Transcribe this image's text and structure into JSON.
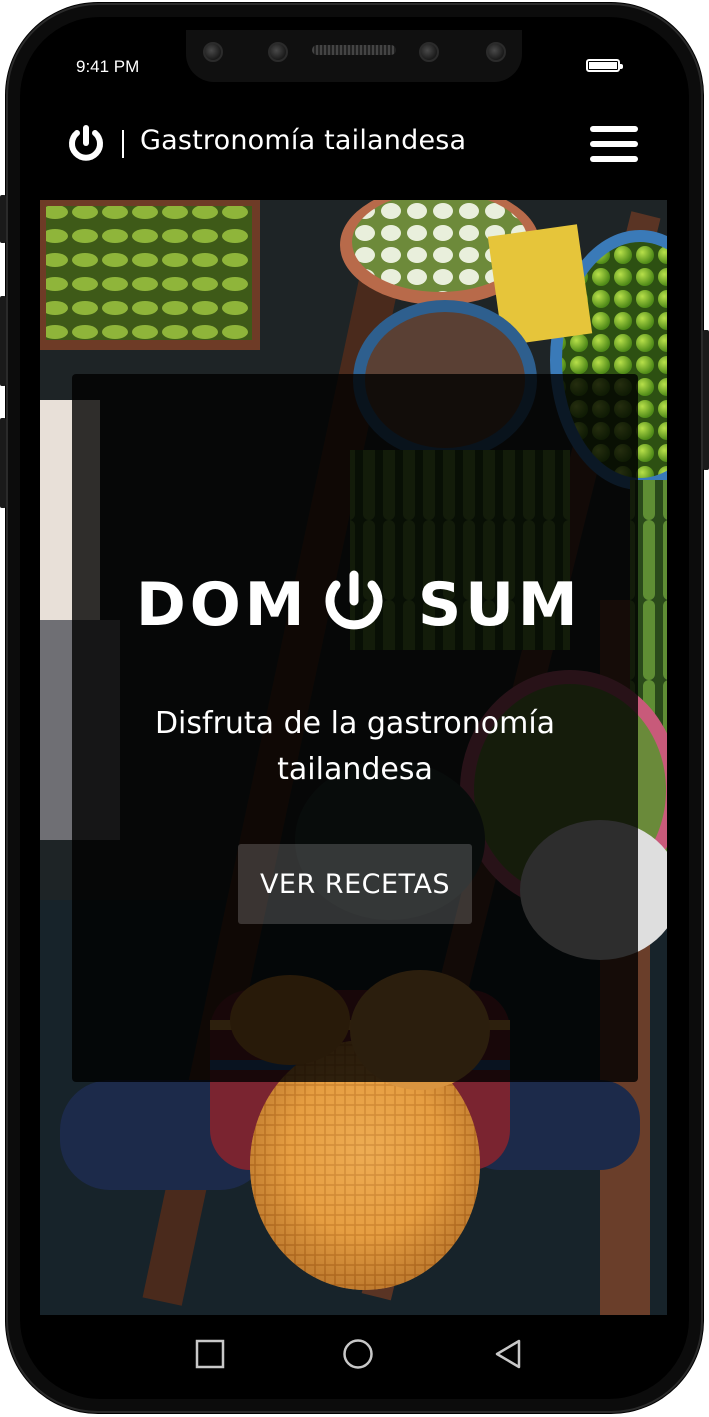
{
  "status_bar": {
    "time": "9:41 PM"
  },
  "header": {
    "title": "Gastronomía tailandesa",
    "brand_icon": "power-icon",
    "menu_icon": "hamburger-menu-icon"
  },
  "hero": {
    "logo_text": "DOM",
    "logo_text_right": "SUM",
    "tagline": "Disfruta de la gastronomía tailandesa",
    "cta_label": "VER RECETAS"
  },
  "nav_bar": {
    "recent_icon": "square-icon",
    "home_icon": "circle-icon",
    "back_icon": "triangle-back-icon"
  },
  "colors": {
    "background": "#000000",
    "text": "#ffffff",
    "card_overlay": "rgba(0,0,0,0.80)"
  }
}
